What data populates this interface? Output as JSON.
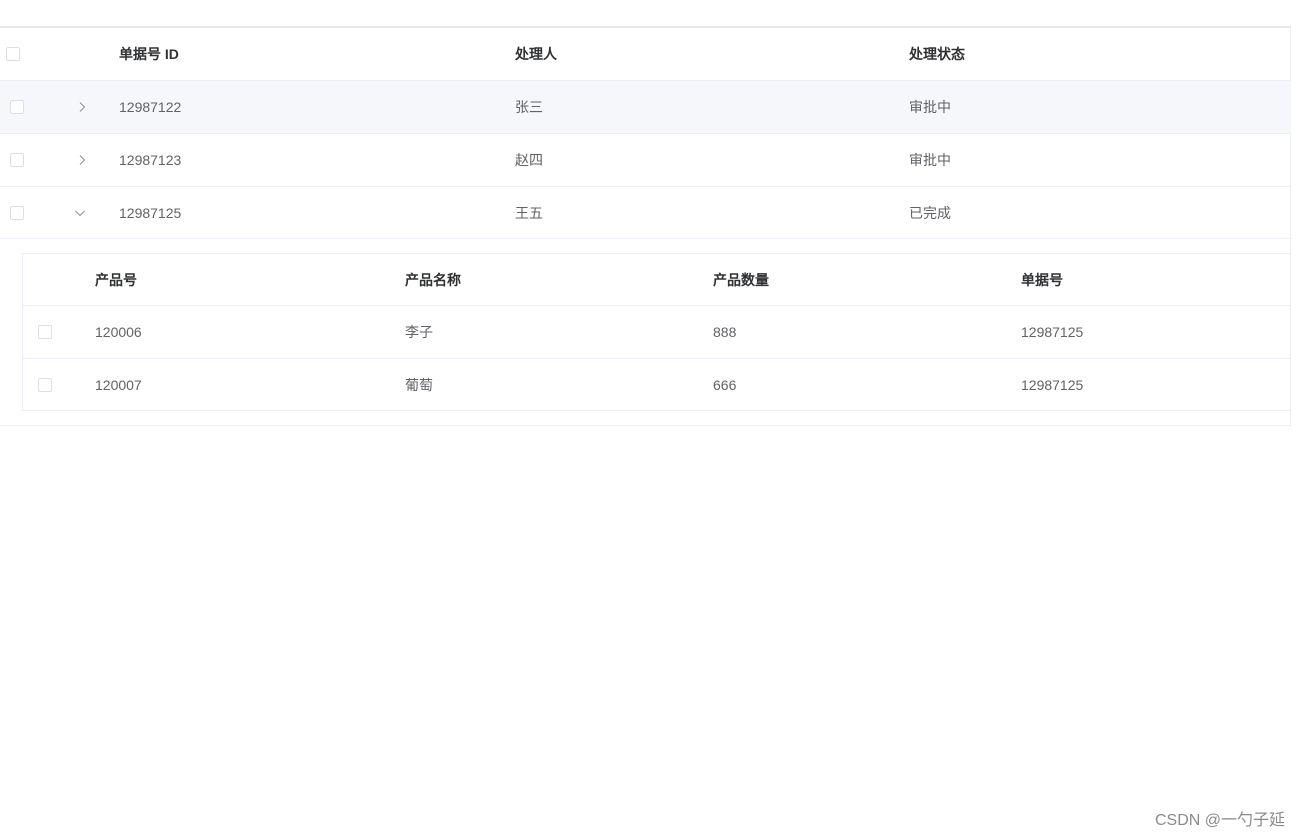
{
  "outer_table": {
    "columns": [
      "单据号 ID",
      "处理人",
      "处理状态"
    ],
    "rows": [
      {
        "id": "12987122",
        "handler": "张三",
        "status": "审批中",
        "expanded": false
      },
      {
        "id": "12987123",
        "handler": "赵四",
        "status": "审批中",
        "expanded": false
      },
      {
        "id": "12987125",
        "handler": "王五",
        "status": "已完成",
        "expanded": true
      }
    ]
  },
  "inner_table": {
    "columns": [
      "产品号",
      "产品名称",
      "产品数量",
      "单据号"
    ],
    "rows": [
      {
        "product_no": "120006",
        "product_name": "李子",
        "quantity": "888",
        "order_no": "12987125"
      },
      {
        "product_no": "120007",
        "product_name": "葡萄",
        "quantity": "666",
        "order_no": "12987125"
      }
    ]
  },
  "watermark": "CSDN @一勺子延",
  "colors": {
    "header_text": "#303133",
    "body_text": "#606266",
    "border": "#ebeef5",
    "hover_row": "#f5f7fa",
    "checkbox_border": "#dcdfe6"
  }
}
